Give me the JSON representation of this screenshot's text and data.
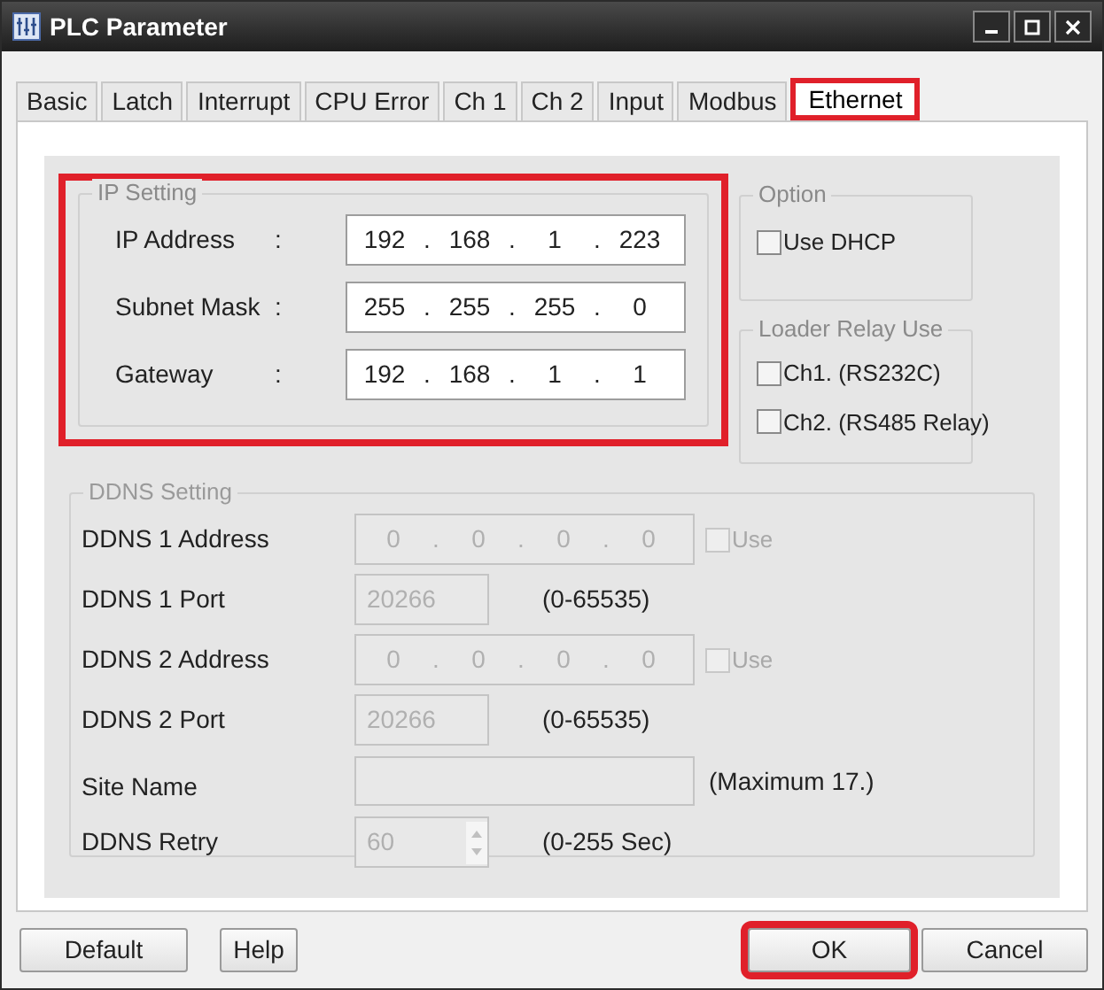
{
  "window": {
    "title": "PLC Parameter"
  },
  "tabs": [
    {
      "label": "Basic",
      "selected": false,
      "highlighted": false
    },
    {
      "label": "Latch",
      "selected": false,
      "highlighted": false
    },
    {
      "label": "Interrupt",
      "selected": false,
      "highlighted": false
    },
    {
      "label": "CPU Error",
      "selected": false,
      "highlighted": false
    },
    {
      "label": "Ch 1",
      "selected": false,
      "highlighted": false
    },
    {
      "label": "Ch 2",
      "selected": false,
      "highlighted": false
    },
    {
      "label": "Input",
      "selected": false,
      "highlighted": false
    },
    {
      "label": "Modbus",
      "selected": false,
      "highlighted": false
    },
    {
      "label": "Ethernet",
      "selected": true,
      "highlighted": true
    }
  ],
  "ip_separator": ".",
  "ip_setting": {
    "title": "IP Setting",
    "highlighted": true,
    "rows": [
      {
        "label": "IP Address",
        "colon": ":",
        "octets": [
          "192",
          "168",
          "1",
          "223"
        ]
      },
      {
        "label": "Subnet Mask",
        "colon": ":",
        "octets": [
          "255",
          "255",
          "255",
          "0"
        ]
      },
      {
        "label": "Gateway",
        "colon": ":",
        "octets": [
          "192",
          "168",
          "1",
          "1"
        ]
      }
    ]
  },
  "option": {
    "title": "Option",
    "items": [
      {
        "label": "Use DHCP",
        "checked": false
      }
    ]
  },
  "loader_relay": {
    "title": "Loader Relay Use",
    "items": [
      {
        "label": "Ch1. (RS232C)",
        "checked": false
      },
      {
        "label": "Ch2. (RS485 Relay)",
        "checked": false
      }
    ]
  },
  "ddns": {
    "title": "DDNS Setting",
    "disabled": true,
    "rows": [
      {
        "kind": "ip",
        "label": "DDNS 1 Address",
        "octets": [
          "0",
          "0",
          "0",
          "0"
        ],
        "use": {
          "label": "Use",
          "checked": false
        }
      },
      {
        "kind": "port",
        "label": "DDNS 1 Port",
        "value": "20266",
        "hint": "(0-65535)"
      },
      {
        "kind": "ip",
        "label": "DDNS 2 Address",
        "octets": [
          "0",
          "0",
          "0",
          "0"
        ],
        "use": {
          "label": "Use",
          "checked": false
        }
      },
      {
        "kind": "port",
        "label": "DDNS 2 Port",
        "value": "20266",
        "hint": "(0-65535)"
      },
      {
        "kind": "text",
        "label": "Site Name",
        "hint": "(Maximum 17.)"
      },
      {
        "kind": "spin",
        "label": "DDNS Retry",
        "value": "60",
        "hint": "(0-255 Sec)"
      }
    ]
  },
  "buttons": [
    {
      "label": "Default",
      "highlighted": false
    },
    {
      "label": "Help",
      "highlighted": false
    },
    {
      "label": "OK",
      "highlighted": true
    },
    {
      "label": "Cancel",
      "highlighted": false
    }
  ]
}
